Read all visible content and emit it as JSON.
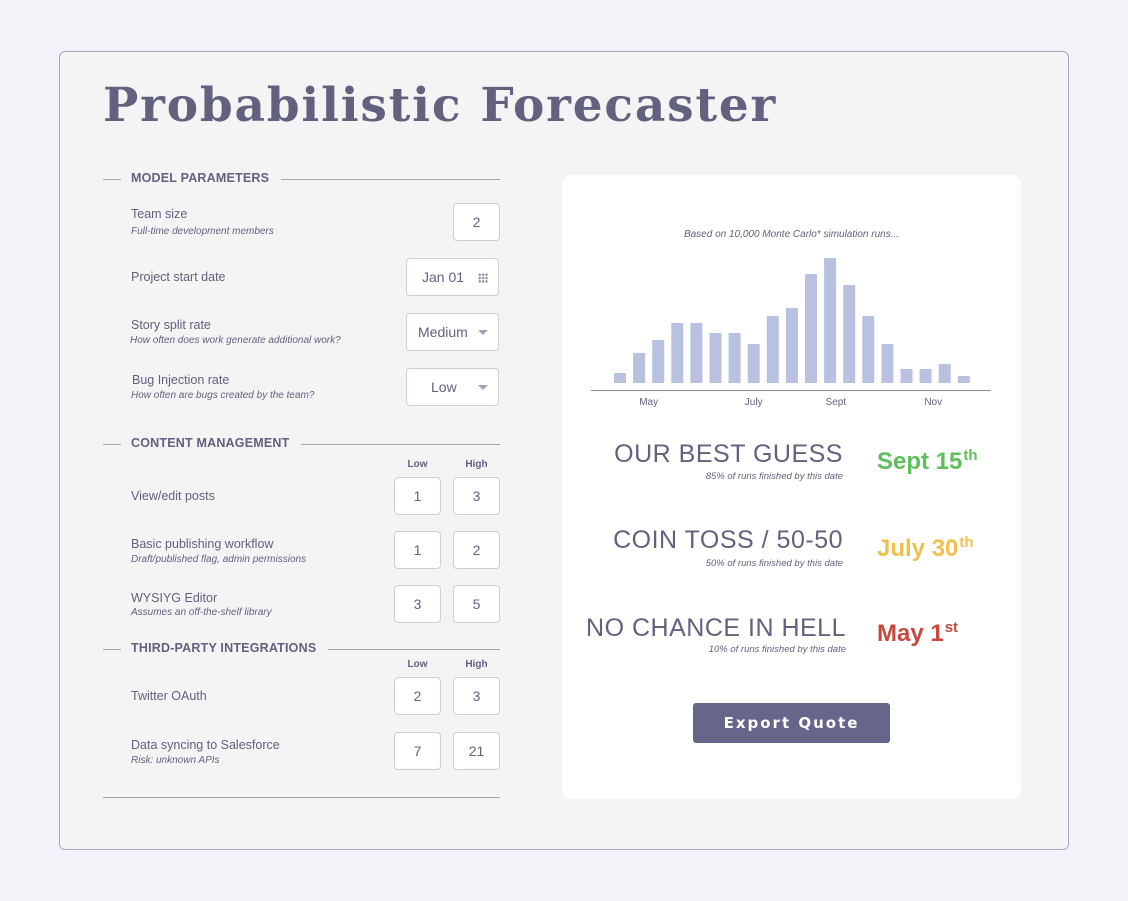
{
  "app_title": "Probabilistic Forecaster",
  "colors": {
    "title_text": "#62617e",
    "bar": "#b8c1e0",
    "best_guess": "#5fbf58",
    "coin_toss": "#f0c04b",
    "no_chance": "#c6493e",
    "button_bg": "#66658a"
  },
  "model_parameters": {
    "heading": "MODEL PARAMETERS",
    "team_size": {
      "label": "Team size",
      "sub": "Full-time development members",
      "value": "2"
    },
    "start_date": {
      "label": "Project start date",
      "value": "Jan 01",
      "icon": "calendar-icon"
    },
    "story_split": {
      "label": "Story split rate",
      "sub": "How often does work generate additional work?",
      "value": "Medium"
    },
    "bug_injection": {
      "label": "Bug Injection rate",
      "sub": "How often are bugs created by the team?",
      "value": "Low"
    }
  },
  "content_management": {
    "heading": "CONTENT MANAGEMENT",
    "col_low": "Low",
    "col_high": "High",
    "rows": [
      {
        "label": "View/edit posts",
        "sub": "",
        "low": "1",
        "high": "3"
      },
      {
        "label": "Basic publishing workflow",
        "sub": "Draft/published flag, admin permissions",
        "low": "1",
        "high": "2"
      },
      {
        "label": "WYSIYG Editor",
        "sub": "Assumes an off-the-shelf library",
        "low": "3",
        "high": "5"
      }
    ]
  },
  "third_party": {
    "heading": "THIRD-PARTY INTEGRATIONS",
    "col_low": "Low",
    "col_high": "High",
    "rows": [
      {
        "label": "Twitter OAuth",
        "sub": "",
        "low": "2",
        "high": "3"
      },
      {
        "label": "Data syncing to Salesforce",
        "sub": "Risk: unknown APIs",
        "low": "7",
        "high": "21"
      }
    ]
  },
  "results": {
    "caption": "Based on 10,000 Monte Carlo* simulation runs...",
    "best_guess": {
      "label": "OUR BEST GUESS",
      "sub": "85% of runs finished by this date",
      "date": "Sept 15",
      "suffix": "th"
    },
    "coin_toss": {
      "label": "COIN TOSS / 50-50",
      "sub": "50% of runs finished by this date",
      "date": "July 30",
      "suffix": "th"
    },
    "no_chance": {
      "label": "NO CHANCE IN HELL",
      "sub": "10% of runs finished by this date",
      "date": "May 1",
      "suffix": "st"
    },
    "export_label": "Export Quote"
  },
  "chart_data": {
    "type": "bar",
    "tick_labels": [
      "May",
      "July",
      "Sept",
      "Nov"
    ],
    "tick_bar_index": [
      1.5,
      7,
      11.3,
      16.4
    ],
    "values": [
      10,
      30,
      43,
      60,
      60,
      50,
      50,
      39,
      67,
      75,
      109,
      125,
      98,
      67,
      39,
      14,
      14,
      19,
      7
    ],
    "ylim": [
      0,
      130
    ],
    "grid": false
  }
}
